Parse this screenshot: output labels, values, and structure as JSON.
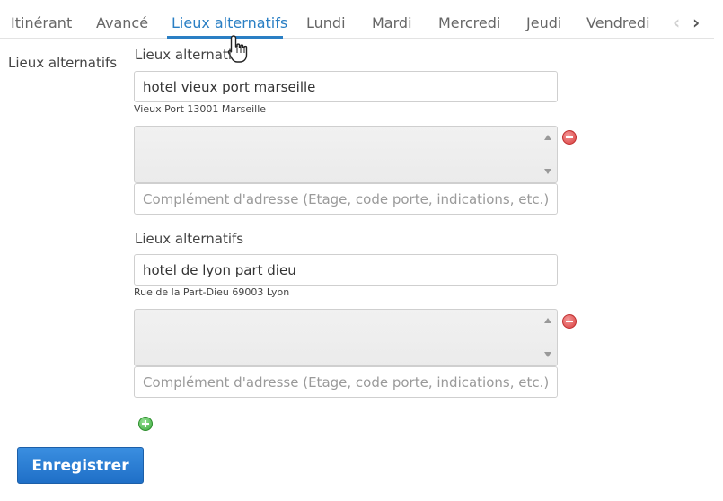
{
  "tabs": [
    {
      "label": "Itinérant"
    },
    {
      "label": "Avancé"
    },
    {
      "label": "Lieux alternatifs"
    },
    {
      "label": "Lundi"
    },
    {
      "label": "Mardi"
    },
    {
      "label": "Mercredi"
    },
    {
      "label": "Jeudi"
    },
    {
      "label": "Vendredi"
    }
  ],
  "active_tab": "Lieux alternatifs",
  "tab_nav": {
    "prev": "‹",
    "next": "›"
  },
  "section_label": "Lieux alternatifs",
  "locations": [
    {
      "label": "Lieux alternati",
      "value": "hotel vieux port marseille",
      "resolved_address": "Vieux Port 13001 Marseille",
      "complement_placeholder": "Complément d'adresse (Etage, code porte, indications, etc.)"
    },
    {
      "label": "Lieux alternatifs",
      "value": "hotel de lyon part dieu",
      "resolved_address": "Rue de la Part-Dieu 69003 Lyon",
      "complement_placeholder": "Complément d'adresse (Etage, code porte, indications, etc.)"
    }
  ],
  "save_label": "Enregistrer",
  "colors": {
    "accent": "#2a7fc4",
    "button": "#1f6fc7",
    "remove": "#d83c3c",
    "add": "#3aa93a"
  }
}
